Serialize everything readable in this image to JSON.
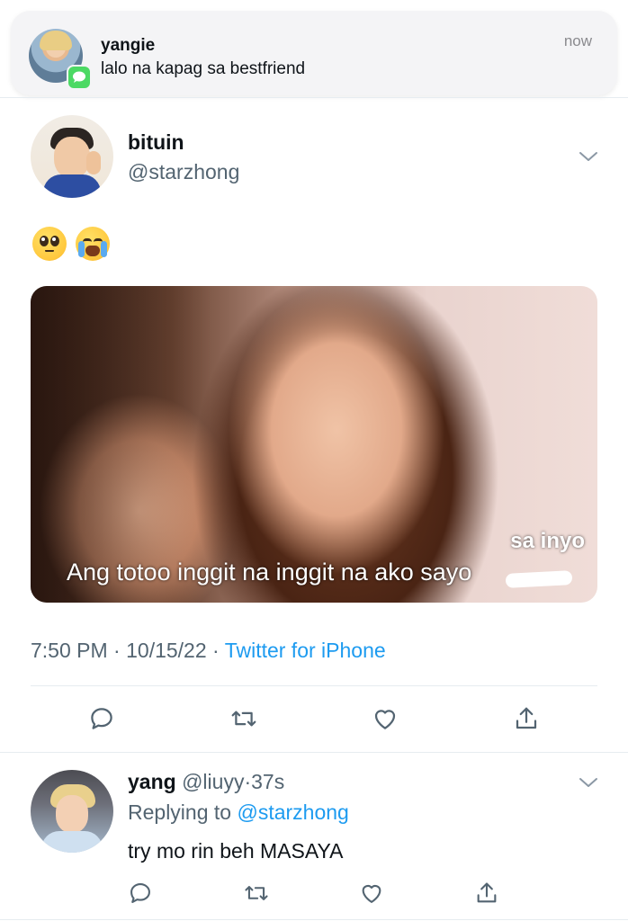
{
  "notification": {
    "sender": "yangie",
    "message": "lalo na kapag sa bestfriend",
    "time": "now"
  },
  "tweet": {
    "display_name": "bituin",
    "handle": "@starzhong",
    "emojis": "🥺 😭",
    "media": {
      "caption_top": "sa inyo",
      "caption_main": "Ang totoo inggit na inggit na ako sayo"
    },
    "time": "7:50 PM",
    "separator": "·",
    "date": "10/15/22",
    "source": "Twitter for iPhone"
  },
  "reply": {
    "display_name": "yang",
    "handle": "@liuyy",
    "separator": "·",
    "age": "37s",
    "replying_prefix": "Replying to",
    "replying_to": "@starzhong",
    "text": "try mo rin beh MASAYA"
  },
  "colors": {
    "link": "#1d9bf0",
    "muted": "#536471",
    "icon": "#536471",
    "messages_badge": "#4cd964"
  }
}
